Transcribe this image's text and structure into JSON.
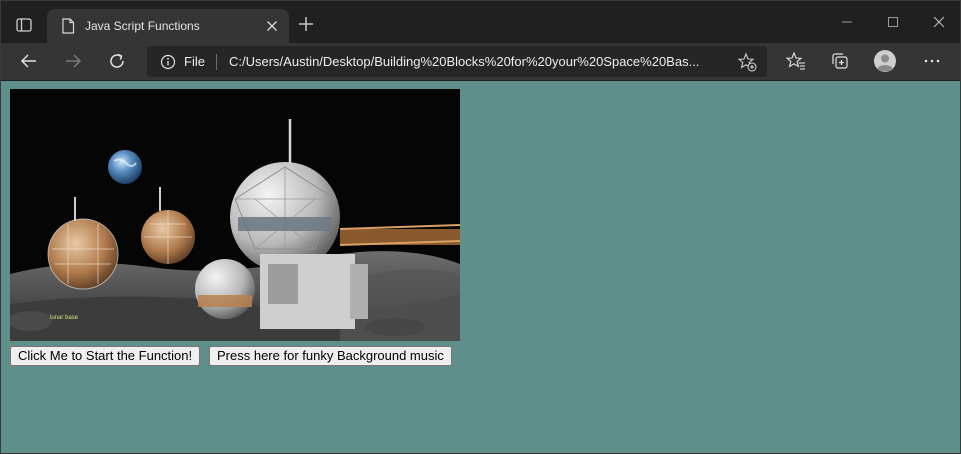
{
  "browser": {
    "tab": {
      "title": "Java Script Functions",
      "icon": "page-icon"
    },
    "address_bar": {
      "scheme_label": "File",
      "url": "C:/Users/Austin/Desktop/Building%20Blocks%20for%20your%20Space%20Bas..."
    },
    "icons": {
      "tab_actions": "tab-actions-icon",
      "new_tab": "plus-icon",
      "minimize": "minimize-icon",
      "maximize": "maximize-icon",
      "close": "close-icon",
      "back": "back-arrow-icon",
      "forward": "forward-arrow-icon",
      "refresh": "refresh-icon",
      "site_info": "info-icon",
      "add_favorite": "star-plus-icon",
      "favorites": "favorites-icon",
      "collections": "collections-icon",
      "profile": "profile-avatar-icon",
      "menu": "more-icon"
    },
    "colors": {
      "chrome_dark": "#202020",
      "toolbar": "#353535",
      "page_background": "#5f8f8b"
    }
  },
  "page": {
    "image_subject": "lunar-base-illustration",
    "buttons": {
      "start_function": "Click Me to Start the Function!",
      "music": "Press here for funky Background music"
    }
  }
}
